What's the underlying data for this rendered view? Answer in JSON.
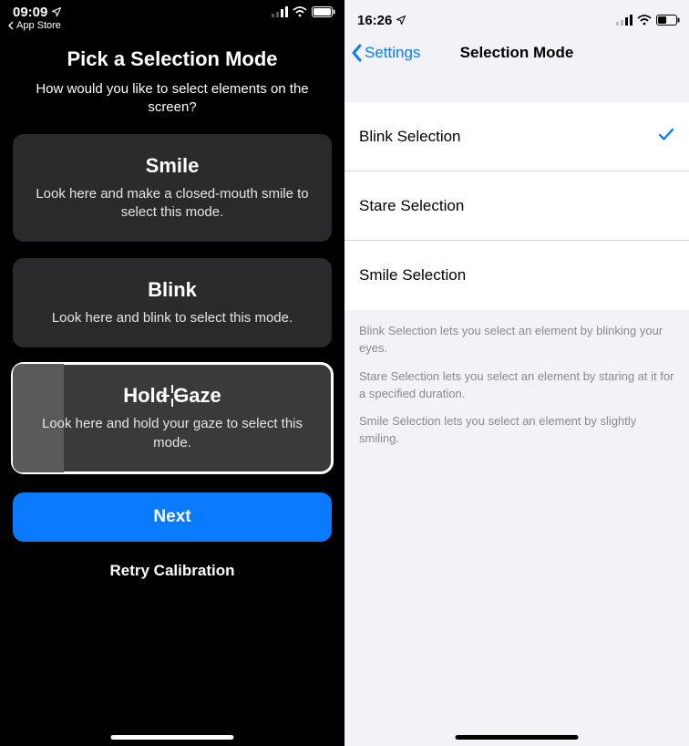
{
  "left": {
    "status": {
      "time": "09:09",
      "backline": "App Store"
    },
    "title": "Pick a Selection Mode",
    "subtitle": "How would you like to select elements on the screen?",
    "cards": [
      {
        "title": "Smile",
        "desc": "Look here and make a closed-mouth smile to select this mode."
      },
      {
        "title": "Blink",
        "desc": "Look here and blink to select this mode."
      },
      {
        "title": "Hold Gaze",
        "desc": "Look here and hold your gaze to select this mode."
      }
    ],
    "next": "Next",
    "retry": "Retry Calibration"
  },
  "right": {
    "status": {
      "time": "16:26"
    },
    "nav_back": "Settings",
    "nav_title": "Selection Mode",
    "rows": [
      {
        "label": "Blink Selection",
        "checked": true
      },
      {
        "label": "Stare Selection",
        "checked": false
      },
      {
        "label": "Smile Selection",
        "checked": false
      }
    ],
    "footer": [
      "Blink Selection lets you select an element by blinking your eyes.",
      "Stare Selection lets you select an element by staring at it for a specified duration.",
      "Smile Selection lets you select an element by slightly smiling."
    ]
  }
}
